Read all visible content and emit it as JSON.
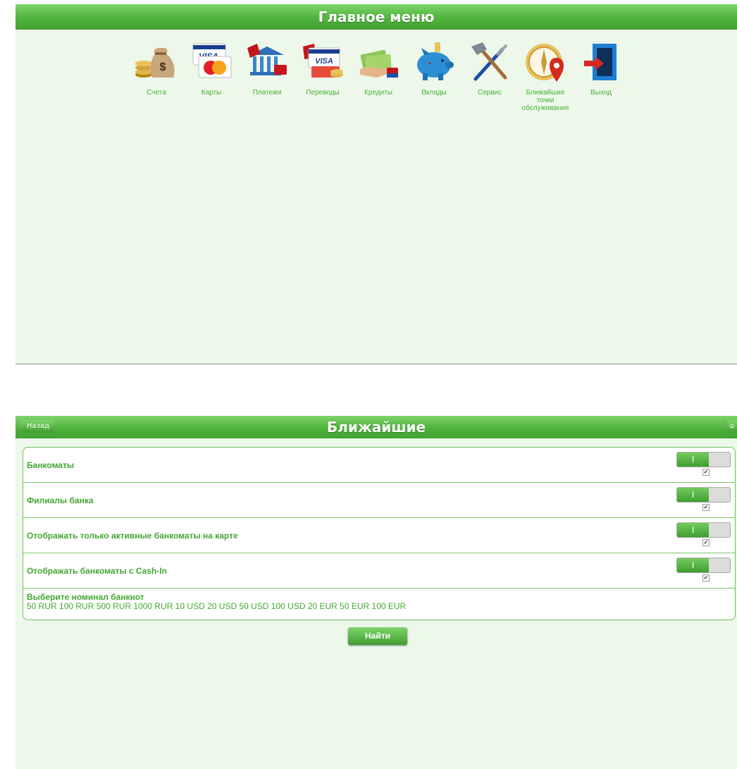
{
  "main_menu": {
    "title": "Главное меню",
    "items": [
      {
        "label": "Счета",
        "icon": "money-bag-icon"
      },
      {
        "label": "Карты",
        "icon": "credit-cards-icon"
      },
      {
        "label": "Платежи",
        "icon": "bank-building-icon"
      },
      {
        "label": "Переводы",
        "icon": "card-transfer-icon"
      },
      {
        "label": "Кредиты",
        "icon": "cash-hand-icon"
      },
      {
        "label": "Вклады",
        "icon": "piggy-bank-icon"
      },
      {
        "label": "Сервис",
        "icon": "tools-icon"
      },
      {
        "label": "Ближайшие\nточки\nобслуживания",
        "icon": "compass-pin-icon"
      },
      {
        "label": "Выход",
        "icon": "exit-door-icon"
      }
    ]
  },
  "nearby": {
    "title": "Ближайшие",
    "back_label": "Назад",
    "home_icon": "home-icon",
    "options": [
      {
        "label": "Банкоматы",
        "checked": true
      },
      {
        "label": "Филиалы банка",
        "checked": true
      },
      {
        "label": "Отображать только активные банкоматы на карте",
        "checked": true
      },
      {
        "label": "Отображать банкоматы с Cash-In",
        "checked": true
      }
    ],
    "toggle_on_text": "I",
    "check_mark": "✔",
    "denominations_title": "Выберите номинал банкнот",
    "denominations": "50 RUR 100 RUR 500 RUR 1000 RUR 10 USD 20 USD 50 USD 100 USD 20 EUR 50 EUR 100 EUR",
    "find_label": "Найти"
  },
  "colors": {
    "accent": "#4fb33c",
    "background": "#edf8ea",
    "text_green": "#43a632"
  }
}
